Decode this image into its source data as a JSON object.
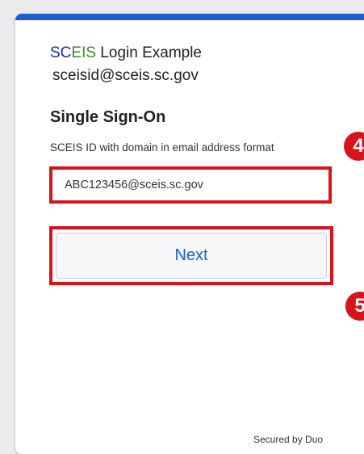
{
  "brand": {
    "prefix": "SC",
    "suffix": "EIS",
    "rest": " Login Example"
  },
  "account_email": "sceisid@sceis.sc.gov",
  "heading": "Single Sign-On",
  "field_label": "SCEIS ID with domain in email address format",
  "input": {
    "value": "ABC123456@sceis.sc.gov"
  },
  "next_button_label": "Next",
  "footer": "Secured by Duo",
  "step_badges": [
    "4",
    "5"
  ],
  "colors": {
    "accent_blue": "#1a5dd6",
    "highlight_red": "#d8131b",
    "brand_sc": "#1f2a8c",
    "brand_eis": "#3a8a2a"
  }
}
